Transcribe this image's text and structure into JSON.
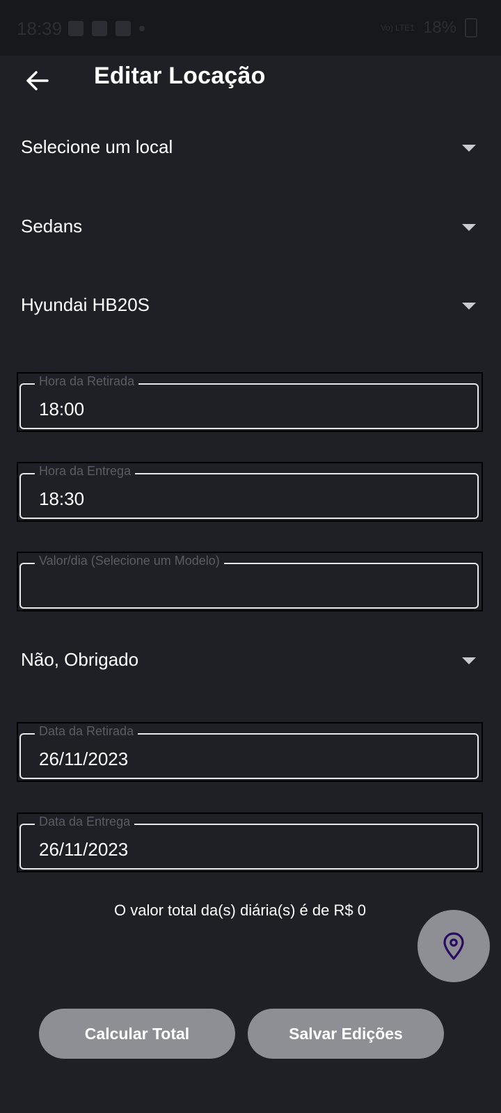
{
  "status_bar": {
    "time": "18:39",
    "battery": "18%",
    "network": "Vo) LTE1"
  },
  "header": {
    "title": "Editar Locação"
  },
  "dropdowns": {
    "local": "Selecione um local",
    "category": "Sedans",
    "model": "Hyundai HB20S",
    "extra": "Não, Obrigado"
  },
  "fields": {
    "pickup_time": {
      "label": "Hora da Retirada",
      "value": "18:00"
    },
    "return_time": {
      "label": "Hora da Entrega",
      "value": "18:30"
    },
    "daily_rate": {
      "label": "Valor/dia (Selecione um Modelo)",
      "value": ""
    },
    "pickup_date": {
      "label": "Data da Retirada",
      "value": "26/11/2023"
    },
    "return_date": {
      "label": "Data da Entrega",
      "value": "26/11/2023"
    }
  },
  "total": {
    "text": "O valor total da(s) diária(s) é de R$ 0"
  },
  "buttons": {
    "calculate": "Calcular Total",
    "save": "Salvar Edições"
  },
  "icons": {
    "back": "arrow-left-icon",
    "fab": "map-pin-icon",
    "dropdown": "caret-down-icon"
  },
  "colors": {
    "background": "#1f2025",
    "button": "#8e8f95",
    "pin": "#2a0a63",
    "label": "#5b5c63"
  }
}
